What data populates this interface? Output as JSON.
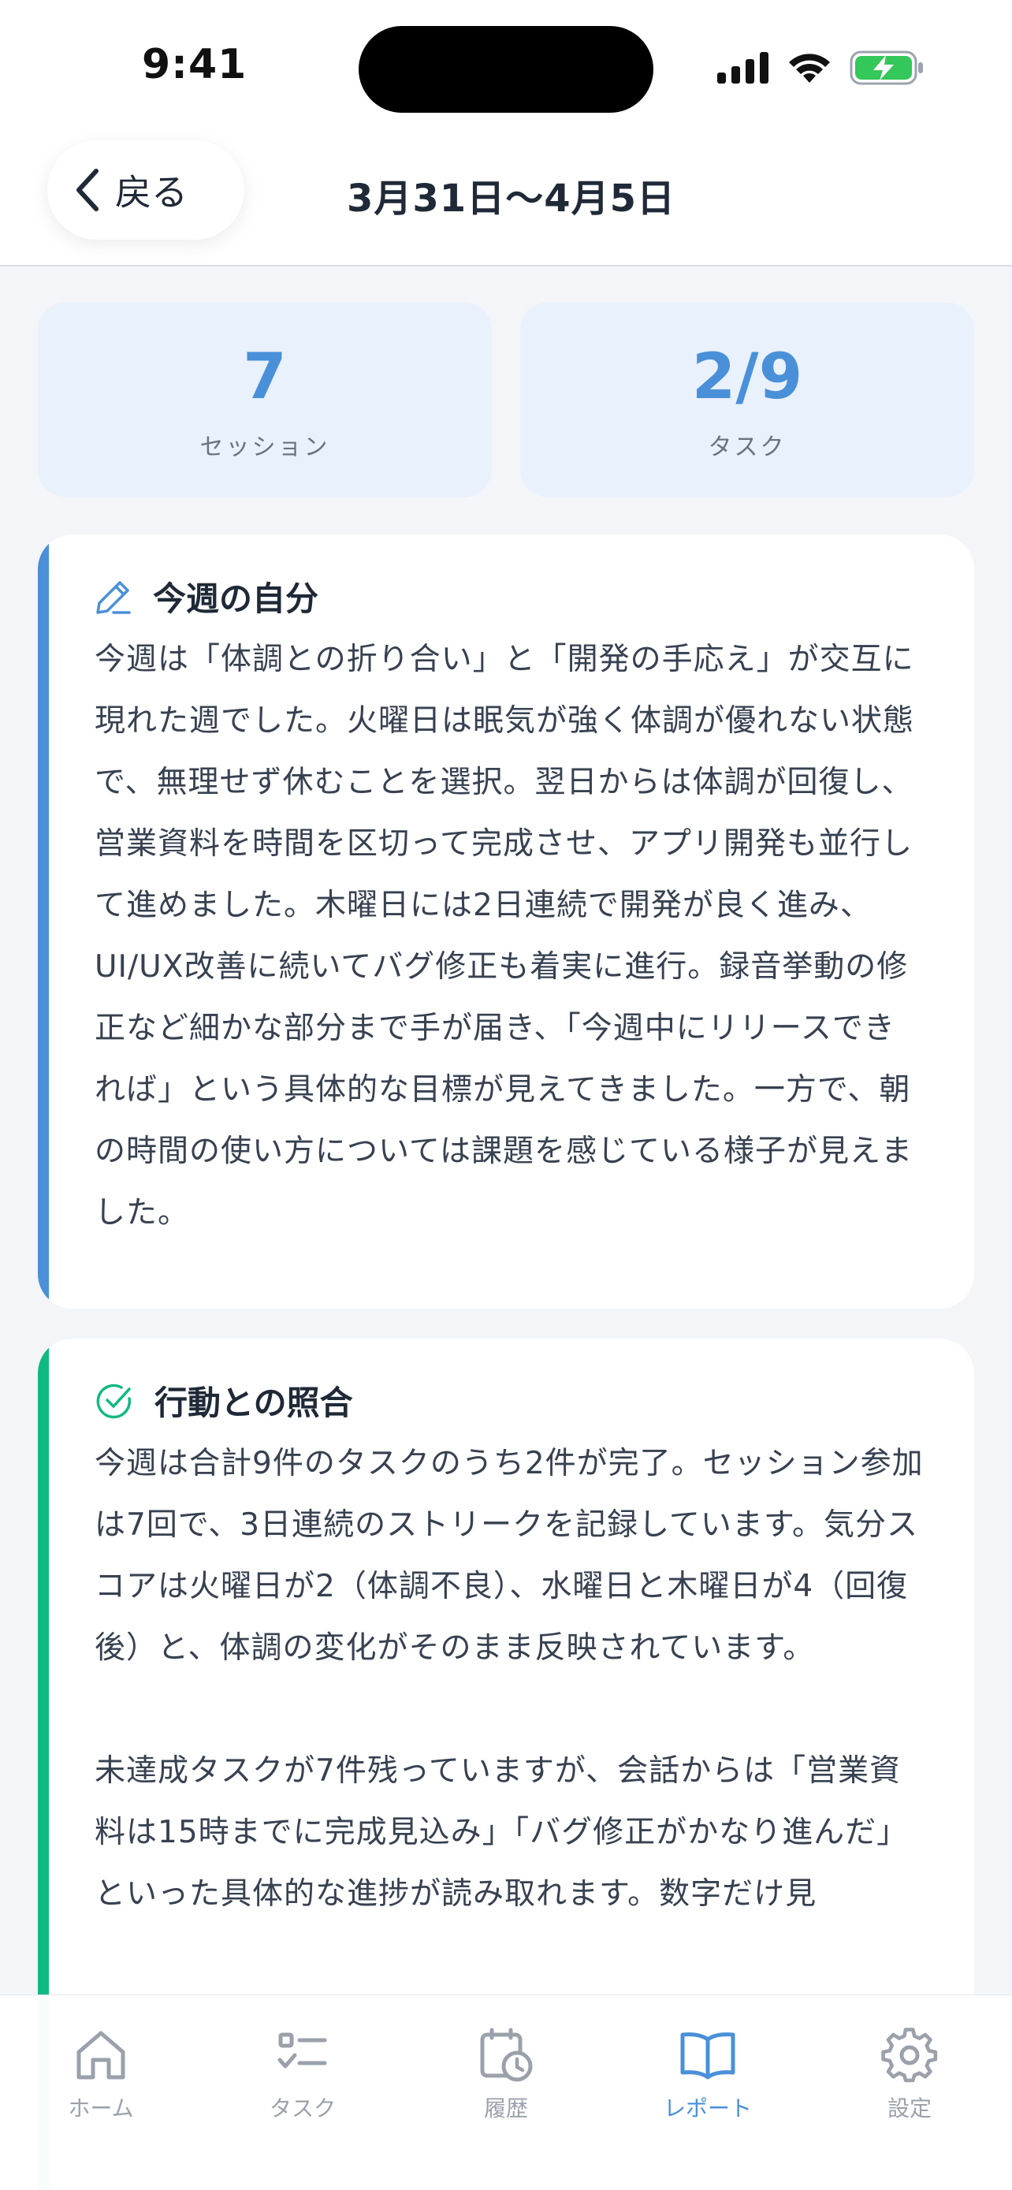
{
  "status_bar": {
    "time": "9:41",
    "icons": [
      "cellular-signal-icon",
      "wifi-icon",
      "battery-charging-icon"
    ]
  },
  "header": {
    "back_label": "戻る",
    "title": "3月31日〜4月5日"
  },
  "stats": [
    {
      "value": "7",
      "label": "セッション"
    },
    {
      "value": "2/9",
      "label": "タスク"
    }
  ],
  "sections": [
    {
      "icon": "pencil-icon",
      "title": "今週の自分",
      "accent": "#4a90d9",
      "body": "今週は「体調との折り合い」と「開発の手応え」が交互に現れた週でした。火曜日は眠気が強く体調が優れない状態で、無理せず休むことを選択。翌日からは体調が回復し、営業資料を時間を区切って完成させ、アプリ開発も並行して進めました。木曜日には2日連続で開発が良く進み、UI/UX改善に続いてバグ修正も着実に進行。録音挙動の修正など細かな部分まで手が届き、「今週中にリリースできれば」という具体的な目標が見えてきました。一方で、朝の時間の使い方については課題を感じている様子が見えました。"
    },
    {
      "icon": "check-circle-icon",
      "title": "行動との照合",
      "accent": "#10b981",
      "body": "今週は合計9件のタスクのうち2件が完了。セッション参加は7回で、3日連続のストリークを記録しています。気分スコアは火曜日が2（体調不良）、水曜日と木曜日が4（回復後）と、体調の変化がそのまま反映されています。\n\n未達成タスクが7件残っていますが、会話からは「営業資料は15時までに完成見込み」「バグ修正がかなり進んだ」といった具体的な進捗が読み取れます。数字だけ見"
    }
  ],
  "tabs": [
    {
      "label": "ホーム",
      "icon": "home-icon",
      "active": false
    },
    {
      "label": "タスク",
      "icon": "task-list-icon",
      "active": false
    },
    {
      "label": "履歴",
      "icon": "calendar-clock-icon",
      "active": false
    },
    {
      "label": "レポート",
      "icon": "open-book-icon",
      "active": true
    },
    {
      "label": "設定",
      "icon": "gear-icon",
      "active": false
    }
  ],
  "colors": {
    "accent_blue": "#4a90d9",
    "accent_green": "#10b981",
    "inactive_tab": "#9aa1ab"
  }
}
